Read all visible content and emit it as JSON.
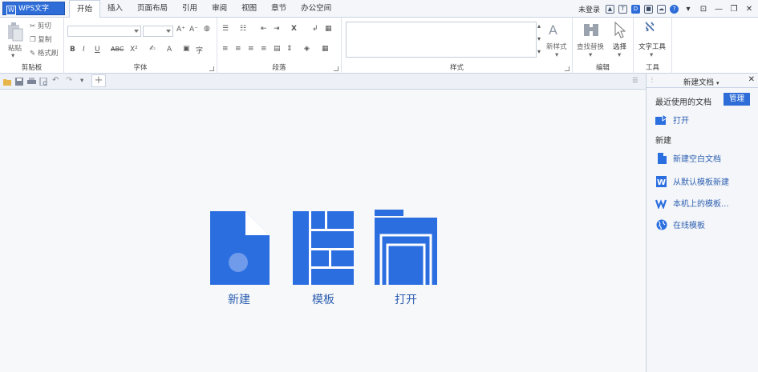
{
  "app": {
    "title": "WPS文字"
  },
  "tabs": [
    "开始",
    "插入",
    "页面布局",
    "引用",
    "审阅",
    "视图",
    "章节",
    "办公空间"
  ],
  "right_tools": {
    "login": "未登录",
    "d_icon": "D"
  },
  "clipboard": {
    "paste": "粘贴",
    "cut": "剪切",
    "copy": "复制",
    "format": "格式刷",
    "group": "剪贴板"
  },
  "font": {
    "grow": "A⁺",
    "shrink": "A⁻",
    "bold": "B",
    "italic": "I",
    "underline": "U",
    "strike": "ABC",
    "super": "X²",
    "color": "A",
    "group": "字体"
  },
  "paragraph": {
    "group": "段落"
  },
  "styles": {
    "group": "样式",
    "new_style": "新样式"
  },
  "editing": {
    "find": "查找替换",
    "select": "选择",
    "group": "编辑"
  },
  "tools": {
    "text_tools": "文字工具",
    "group": "工具"
  },
  "main": {
    "new_label": "新建",
    "template_label": "模板",
    "open_label": "打开"
  },
  "colors": {
    "accent": "#2e6dd8",
    "link": "#2d5fb0"
  },
  "pane": {
    "title": "新建文档",
    "recent": "最近使用的文档",
    "manage": "管理",
    "open": "打开",
    "new_section": "新建",
    "new_blank": "新建空白文档",
    "from_default": "从默认模板新建",
    "local_template": "本机上的模板...",
    "online_template": "在线模板"
  }
}
